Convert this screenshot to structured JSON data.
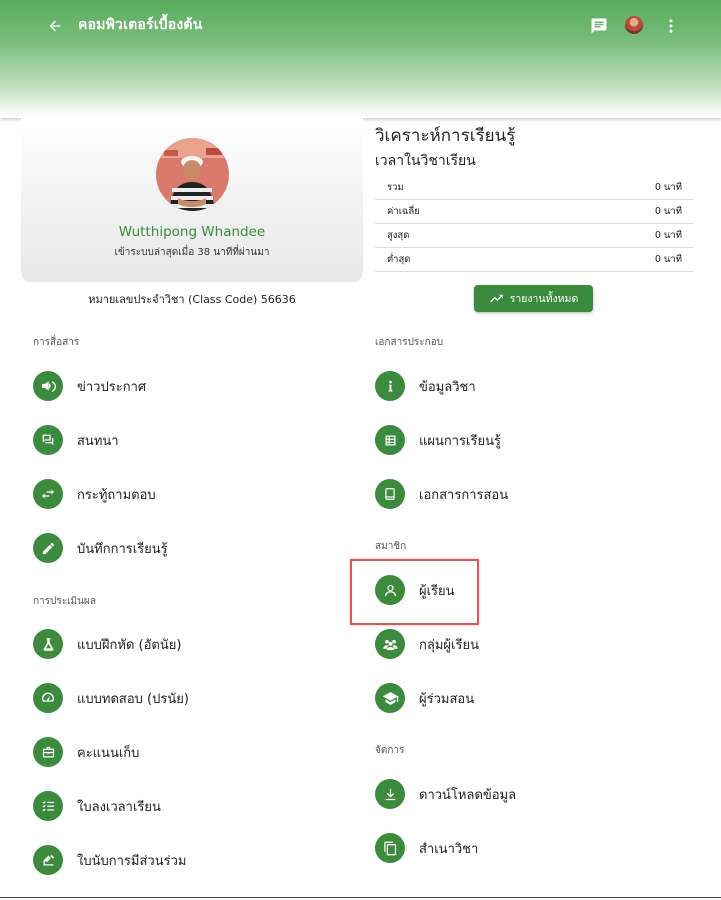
{
  "appbar": {
    "title": "คอมพิวเตอร์เบื้องต้น",
    "back_icon": "arrow-left-icon",
    "chat_icon": "message-icon",
    "more_icon": "more-vert-icon"
  },
  "profile": {
    "name": "Wutthipong Whandee",
    "last_login": "เข้าระบบล่าสุดเมื่อ 38 นาทีที่ผ่านมา",
    "class_code": "หมายเลขประจำวิชา (Class Code) 56636"
  },
  "analytics": {
    "title": "วิเคราะห์การเรียนรู้",
    "subtitle": "เวลาในวิชาเรียน",
    "rows": [
      {
        "label": "รวม",
        "value": "0 นาที"
      },
      {
        "label": "ค่าเฉลี่ย",
        "value": "0 นาที"
      },
      {
        "label": "สูงสุด",
        "value": "0 นาที"
      },
      {
        "label": "ต่ำสุด",
        "value": "0 นาที"
      }
    ],
    "report_button": "รายงานทั้งหมด"
  },
  "sections": {
    "communication": "การสื่อสาร",
    "assessment": "การประเมินผล",
    "documents": "เอกสารประกอบ",
    "members": "สมาชิก",
    "manage": "จัดการ"
  },
  "menu": {
    "announcement": "ข่าวประกาศ",
    "discussion": "สนทนา",
    "qa": "กระทู้ถามตอบ",
    "learning_log": "บันทึกการเรียนรู้",
    "exercise": "แบบฝึกหัด (อัตนัย)",
    "test": "แบบทดสอบ (ปรนัย)",
    "scores": "คะแนนเก็บ",
    "attendance": "ใบลงเวลาเรียน",
    "participation": "ใบนับการมีส่วนร่วม",
    "course_info": "ข้อมูลวิชา",
    "lesson_plan": "แผนการเรียนรู้",
    "teaching_docs": "เอกสารการสอน",
    "students": "ผู้เรียน",
    "student_groups": "กลุ่มผู้เรียน",
    "co_teachers": "ผู้ร่วมสอน",
    "download": "ดาวน์โหลดข้อมูล",
    "copy_course": "สำเนาวิชา"
  },
  "colors": {
    "primary": "#3b8a3e",
    "highlight": "#e05656"
  }
}
